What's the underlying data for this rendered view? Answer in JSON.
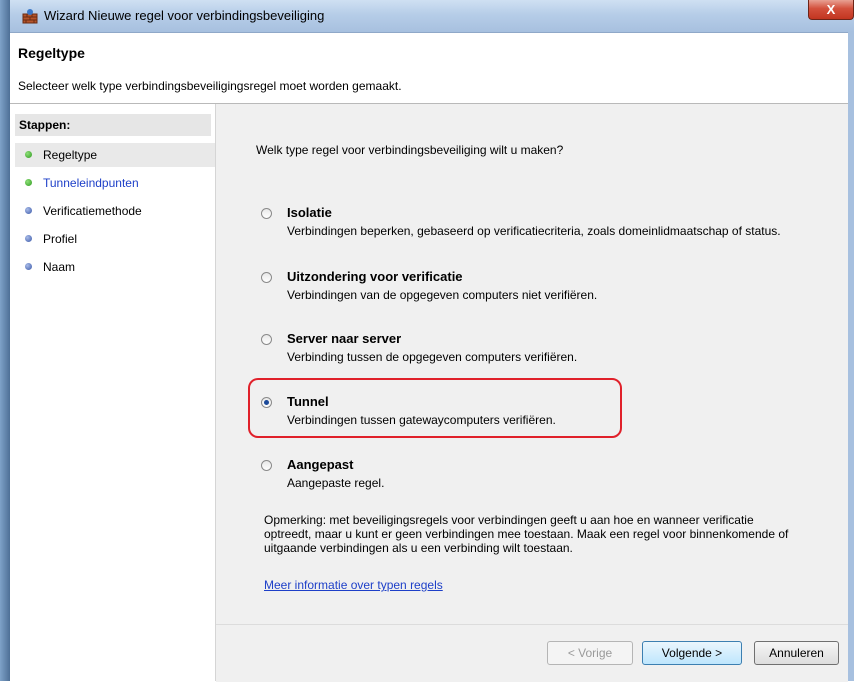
{
  "window": {
    "title": "Wizard Nieuwe regel voor verbindingsbeveiliging",
    "close_label": "X"
  },
  "header": {
    "title": "Regeltype",
    "subtitle": "Selecteer welk type verbindingsbeveiligingsregel moet worden gemaakt."
  },
  "steps": {
    "title": "Stappen:",
    "items": [
      {
        "label": "Regeltype",
        "bullet": "green"
      },
      {
        "label": "Tunneleindpunten",
        "bullet": "green"
      },
      {
        "label": "Verificatiemethode",
        "bullet": "blue"
      },
      {
        "label": "Profiel",
        "bullet": "blue"
      },
      {
        "label": "Naam",
        "bullet": "blue"
      }
    ]
  },
  "main": {
    "question": "Welk type regel voor verbindingsbeveiliging wilt u maken?",
    "options": [
      {
        "label": "Isolatie",
        "desc": "Verbindingen beperken, gebaseerd op verificatiecriteria, zoals domeinlidmaatschap of status.",
        "checked": false
      },
      {
        "label": "Uitzondering voor verificatie",
        "desc": "Verbindingen van de opgegeven computers niet verifiëren.",
        "checked": false
      },
      {
        "label": "Server naar server",
        "desc": "Verbinding tussen de opgegeven computers verifiëren.",
        "checked": false
      },
      {
        "label": "Tunnel",
        "desc": "Verbindingen tussen gatewaycomputers verifiëren.",
        "checked": true
      },
      {
        "label": "Aangepast",
        "desc": "Aangepaste regel.",
        "checked": false
      }
    ],
    "note": "Opmerking: met beveiligingsregels voor verbindingen geeft u aan hoe en wanneer verificatie optreedt, maar u kunt er geen verbindingen mee toestaan. Maak een regel voor binnenkomende of uitgaande verbindingen als u een verbinding wilt toestaan.",
    "more_link": "Meer informatie over typen regels"
  },
  "buttons": {
    "back": "< Vorige",
    "next": "Volgende >",
    "cancel": "Annuleren"
  },
  "colors": {
    "highlight": "#e0202a",
    "link": "#1d3fc8"
  }
}
